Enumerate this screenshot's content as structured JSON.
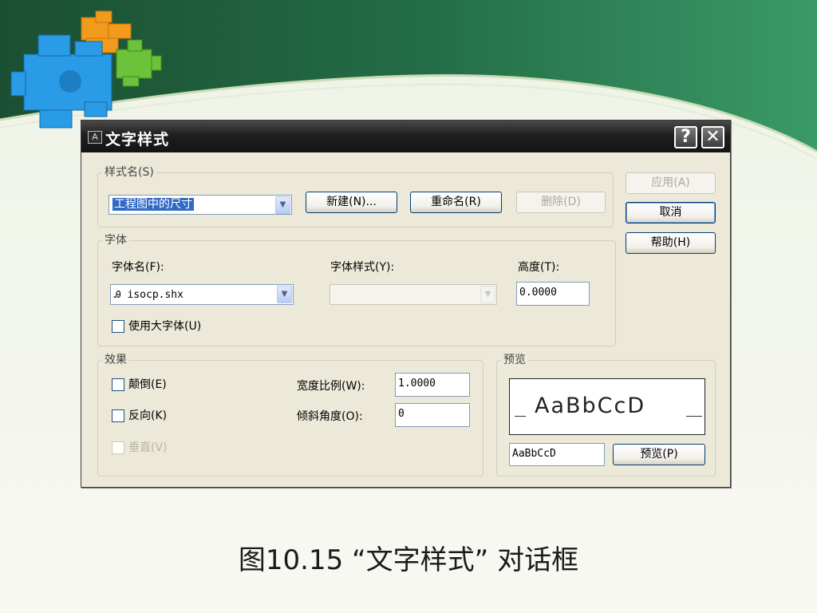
{
  "dialog": {
    "title": "文字样式",
    "title_icon": "text-style-icon",
    "help_glyph": "?",
    "close_glyph": "✕"
  },
  "style_name": {
    "group_label": "样式名(S)",
    "selected": "工程图中的尺寸",
    "new_label": "新建(N)...",
    "rename_label": "重命名(R)",
    "delete_label": "删除(D)"
  },
  "side_buttons": {
    "apply_label": "应用(A)",
    "cancel_label": "取消",
    "help_label": "帮助(H)"
  },
  "font": {
    "group_label": "字体",
    "font_name_label": "字体名(F):",
    "font_name_value": "isocp.shx",
    "font_style_label": "字体样式(Y):",
    "font_style_value": "",
    "height_label": "高度(T):",
    "height_value": "0.0000",
    "use_bigfont_label": "使用大字体(U)",
    "use_bigfont_checked": false
  },
  "effects": {
    "group_label": "效果",
    "upside_down_label": "颠倒(E)",
    "upside_down_checked": false,
    "backwards_label": "反向(K)",
    "backwards_checked": false,
    "vertical_label": "垂直(V)",
    "vertical_checked": false,
    "width_factor_label": "宽度比例(W):",
    "width_factor_value": "1.0000",
    "oblique_label": "倾斜角度(O):",
    "oblique_value": "0"
  },
  "preview": {
    "group_label": "预览",
    "sample_display": "AaBbCcD",
    "sample_input": "AaBbCcD",
    "preview_button_label": "预览(P)"
  },
  "caption": "图10.15 “文字样式” 对话框",
  "colors": {
    "slide_green_dark": "#1f5e3c",
    "slide_green": "#2e8a5a",
    "dialog_face": "#ece9d8",
    "titlebar": "#1f1f1f",
    "group_label": "#0046d5"
  }
}
